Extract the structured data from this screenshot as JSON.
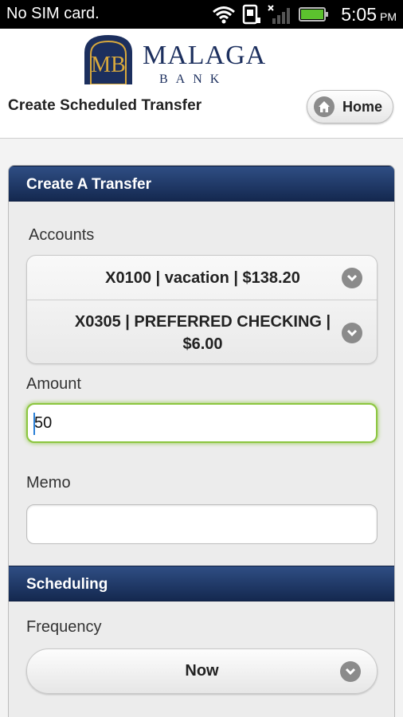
{
  "status_bar": {
    "carrier": "No SIM card.",
    "time": "5:05",
    "ampm": "PM",
    "icons": [
      "wifi-icon",
      "sim-icon",
      "signal-icon",
      "battery-icon"
    ]
  },
  "header": {
    "logo_monogram": "MB",
    "logo_name": "MALAGA",
    "logo_sub": "BANK",
    "page_title": "Create Scheduled Transfer",
    "home_label": "Home"
  },
  "transfer": {
    "section_title": "Create A Transfer",
    "accounts_label": "Accounts",
    "from_account": "X0100 | vacation | $138.20",
    "to_account": "X0305 | PREFERRED CHECKING | $6.00",
    "amount_label": "Amount",
    "amount_value": "50",
    "memo_label": "Memo",
    "memo_value": ""
  },
  "scheduling": {
    "section_title": "Scheduling",
    "frequency_label": "Frequency",
    "frequency_value": "Now"
  },
  "colors": {
    "section_bar": "#1f3766",
    "focus_border": "#8cc63f",
    "brand_navy": "#1c2f5e",
    "brand_gold": "#d9a93c"
  }
}
